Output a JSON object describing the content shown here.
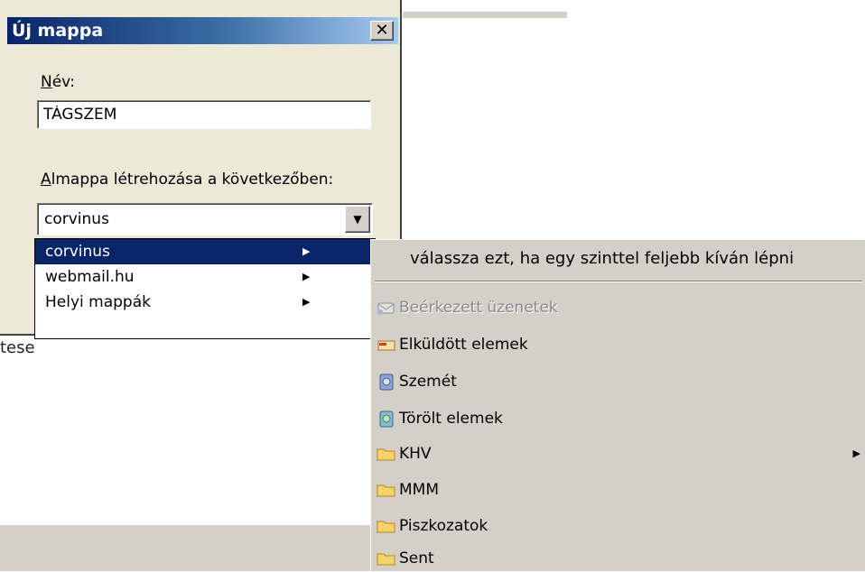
{
  "dialog": {
    "title": "Új mappa",
    "close_label": "✕",
    "name_label_first": "N",
    "name_label_rest": "év:",
    "name_value": "TÁGSZEM",
    "parent_label_first": "A",
    "parent_label_rest": "lmappa létrehozása a következőben:",
    "parent_selected": "corvinus"
  },
  "dropdown": {
    "items": [
      {
        "label": "corvinus",
        "selected": true
      },
      {
        "label": "webmail.hu",
        "selected": false
      },
      {
        "label": "Helyi mappák",
        "selected": false
      }
    ]
  },
  "submenu": {
    "header": "válassza ezt, ha egy szinttel feljebb kíván lépni",
    "items": [
      {
        "label": "Beérkezett üzenetek",
        "icon": "inbox-icon",
        "disabled": true
      },
      {
        "label": "Elküldött elemek",
        "icon": "sent-icon",
        "disabled": false
      },
      {
        "label": "Szemét",
        "icon": "trash-icon",
        "disabled": false
      },
      {
        "label": "Törölt elemek",
        "icon": "deleted-icon",
        "disabled": false
      },
      {
        "label": "KHV",
        "icon": "folder-icon",
        "disabled": false,
        "has_submenu": true
      },
      {
        "label": "MMM",
        "icon": "folder-icon",
        "disabled": false
      },
      {
        "label": "Piszkozatok",
        "icon": "folder-icon",
        "disabled": false
      },
      {
        "label": "Sent",
        "icon": "folder-icon",
        "disabled": false
      }
    ]
  },
  "background": {
    "fragment_text": "tese"
  },
  "colors": {
    "selection": "#0a246a",
    "menu_bg": "#d4d0c8",
    "dialog_bg": "#ece9d8",
    "folder": "#f2c94c"
  }
}
